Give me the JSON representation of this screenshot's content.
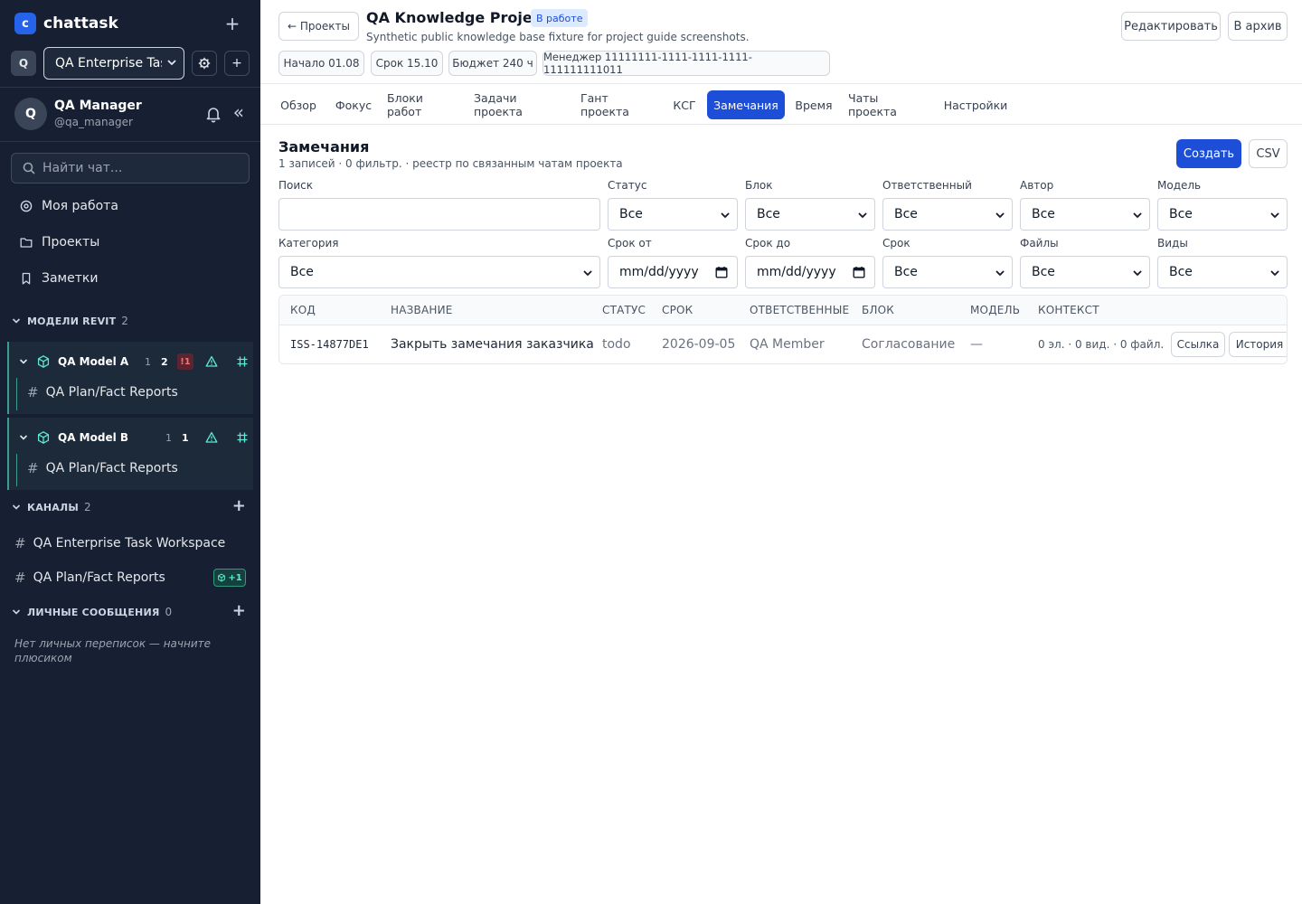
{
  "brand": {
    "logo_letter": "c",
    "name": "chattask"
  },
  "workspace": {
    "avatar_letter": "Q",
    "selected": "QA Enterprise Task Workspace",
    "settings_icon": "gear-icon"
  },
  "user": {
    "avatar_letter": "Q",
    "name": "QA Manager",
    "handle": "@qa_manager"
  },
  "search": {
    "placeholder": "Найти чат..."
  },
  "nav": [
    {
      "label": "Моя работа",
      "icon": "target-icon"
    },
    {
      "label": "Проекты",
      "icon": "folder-icon"
    },
    {
      "label": "Заметки",
      "icon": "bookmark-icon"
    }
  ],
  "sections": {
    "models": {
      "title": "МОДЕЛИ REVIT",
      "count": "2"
    },
    "channels": {
      "title": "КАНАЛЫ",
      "count": "2"
    },
    "dms": {
      "title": "ЛИЧНЫЕ СООБЩЕНИЯ",
      "count": "0",
      "empty": "Нет личных переписок — начните плюсиком"
    }
  },
  "models": [
    {
      "name": "QA Model A",
      "count1": "1",
      "count2": "2",
      "alert": "!1",
      "channel": "QA Plan/Fact Reports"
    },
    {
      "name": "QA Model B",
      "count1": "1",
      "count2": "1",
      "channel": "QA Plan/Fact Reports"
    }
  ],
  "channels": [
    {
      "name": "QA Enterprise Task Workspace"
    },
    {
      "name": "QA Plan/Fact Reports",
      "badge": "+1"
    }
  ],
  "project": {
    "back_label": "← Проекты",
    "title": "QA Knowledge Project",
    "status": "В работе",
    "description": "Synthetic public knowledge base fixture for project guide screenshots.",
    "edit_label": "Редактировать",
    "archive_label": "В архив",
    "chips": {
      "start": "Начало 01.08",
      "due": "Срок 15.10",
      "budget": "Бюджет 240 ч",
      "manager": "Менеджер 11111111-1111-1111-1111-111111111011"
    }
  },
  "tabs": [
    {
      "label": "Обзор"
    },
    {
      "label": "Фокус"
    },
    {
      "label": "Блоки работ"
    },
    {
      "label": "Задачи проекта"
    },
    {
      "label": "Гант проекта"
    },
    {
      "label": "КСГ"
    },
    {
      "label": "Замечания",
      "active": true
    },
    {
      "label": "Время"
    },
    {
      "label": "Чаты проекта"
    },
    {
      "label": "Настройки"
    }
  ],
  "issues": {
    "title": "Замечания",
    "subtitle": "1 записей · 0 фильтр. · реестр по связанным чатам проекта",
    "create_label": "Создать",
    "csv_label": "CSV",
    "filters": {
      "search": {
        "label": "Поиск",
        "value": ""
      },
      "status": {
        "label": "Статус",
        "value": "Все"
      },
      "block": {
        "label": "Блок",
        "value": "Все"
      },
      "assignee": {
        "label": "Ответственный",
        "value": "Все"
      },
      "author": {
        "label": "Автор",
        "value": "Все"
      },
      "model": {
        "label": "Модель",
        "value": "Все"
      },
      "category": {
        "label": "Категория",
        "value": "Все"
      },
      "due_from": {
        "label": "Срок от",
        "value": "mm/dd/yyyy"
      },
      "due_to": {
        "label": "Срок до",
        "value": "mm/dd/yyyy"
      },
      "due": {
        "label": "Срок",
        "value": "Все"
      },
      "files": {
        "label": "Файлы",
        "value": "Все"
      },
      "views": {
        "label": "Виды",
        "value": "Все"
      }
    },
    "columns": [
      "КОД",
      "НАЗВАНИЕ",
      "СТАТУС",
      "СРОК",
      "ОТВЕТСТВЕННЫЕ",
      "БЛОК",
      "МОДЕЛЬ",
      "КОНТЕКСТ"
    ],
    "rows": [
      {
        "code": "ISS-14877DE1",
        "name": "Закрыть замечания заказчика",
        "status": "todo",
        "due": "2026-09-05",
        "assignee": "QA Member",
        "block": "Согласование",
        "model": "—",
        "context": "0 эл. · 0 вид. · 0 файл.",
        "link_label": "Ссылка",
        "history_label": "История"
      }
    ]
  },
  "colors": {
    "sidebar_bg": "#172033",
    "accent": "#1d4ed8",
    "model_accent": "#3b9e8c",
    "alert": "#f87171"
  }
}
